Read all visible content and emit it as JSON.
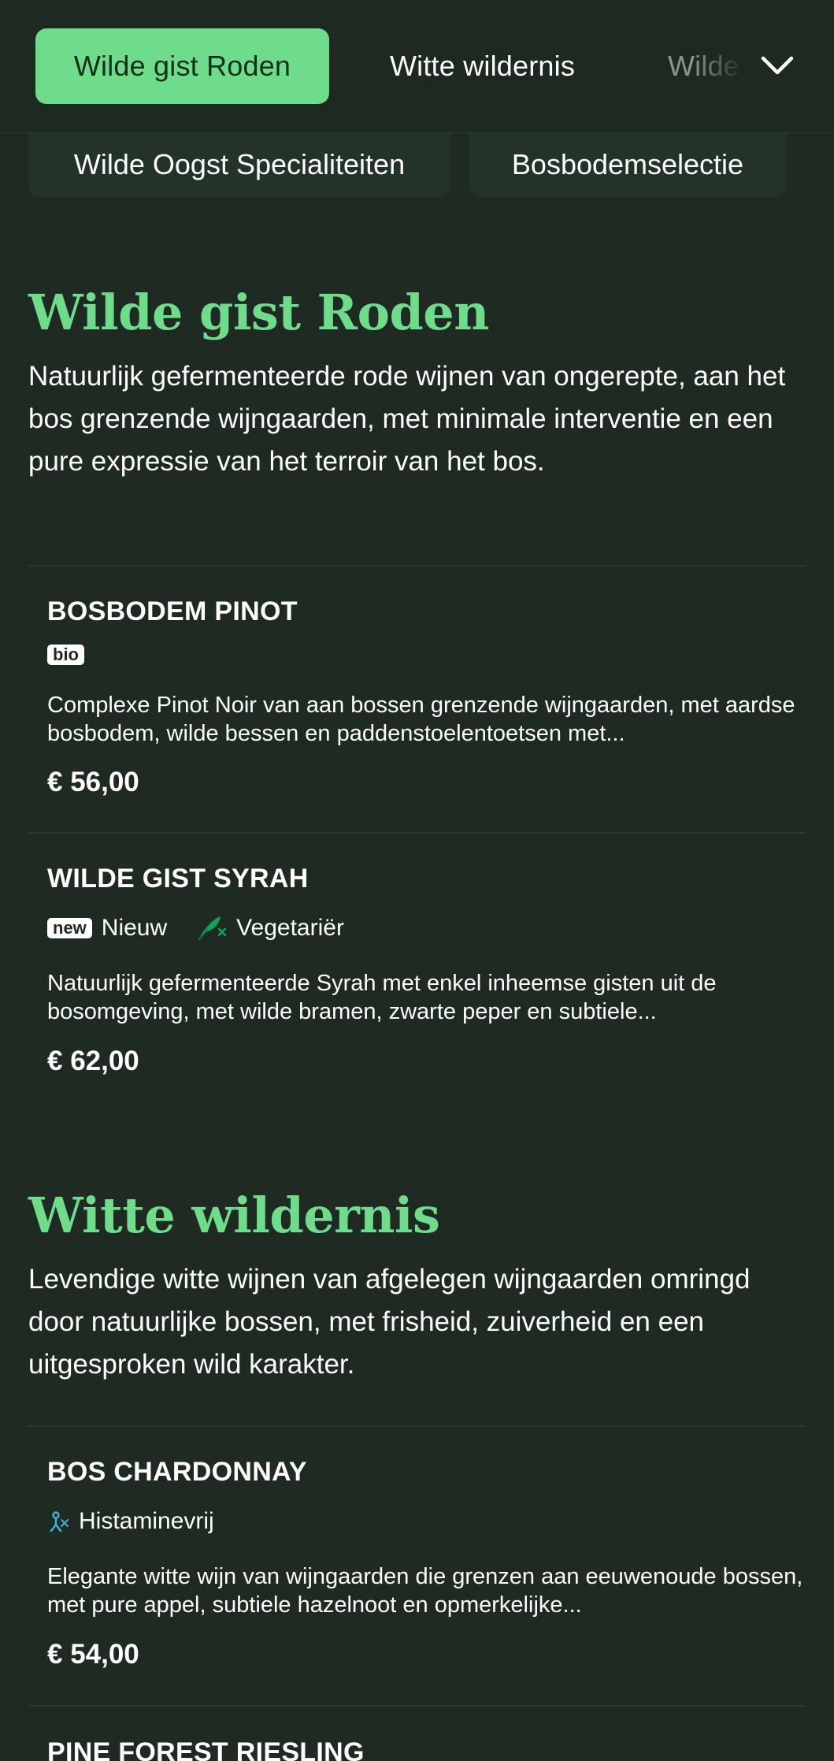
{
  "nav": {
    "tabs": [
      {
        "label": "Wilde gist Roden",
        "active": true
      },
      {
        "label": "Witte wildernis",
        "active": false
      },
      {
        "label": "Wilde",
        "active": false
      }
    ],
    "categories": [
      "Wilde Oogst Specialiteiten",
      "Bosbodemselectie"
    ],
    "dropdown_icon": "chevron-down-icon"
  },
  "sections": [
    {
      "title": "Wilde gist Roden",
      "description": "Natuurlijk gefermenteerde rode wijnen van ongerepte, aan het bos grenzende wijngaarden, met minimale interventie en een pure expressie van het terroir van het bos.",
      "items": [
        {
          "name": "BOSBODEM PINOT",
          "badges": [
            "bio"
          ],
          "tags": [],
          "description": "Complexe Pinot Noir van aan bossen grenzende wijngaarden, met aardse bosbodem, wilde bessen en paddenstoelentoetsen met...",
          "price": "€ 56,00"
        },
        {
          "name": "WILDE GIST SYRAH",
          "badges": [
            "new"
          ],
          "tags": [
            "Nieuw",
            "Vegetariër"
          ],
          "description": "Natuurlijk gefermenteerde Syrah met enkel inheemse gisten uit de bosomgeving, met wilde bramen, zwarte peper en subtiele...",
          "price": "€ 62,00"
        }
      ]
    },
    {
      "title": "Witte wildernis",
      "description": "Levendige witte wijnen van afgelegen wijngaarden omringd door natuurlijke bossen, met frisheid, zuiverheid en een uitgesproken wild karakter.",
      "items": [
        {
          "name": "BOS CHARDONNAY",
          "badges": [],
          "tags": [
            "Histaminevrij"
          ],
          "description": "Elegante witte wijn van wijngaarden die grenzen aan eeuwenoude bossen, met pure appel, subtiele hazelnoot en opmerkelijke...",
          "price": "€ 54,00"
        },
        {
          "name": "PINE FOREST RIESLING",
          "badges": [],
          "tags": [],
          "description": "",
          "price": ""
        }
      ]
    }
  ],
  "colors": {
    "background": "#1f2a22",
    "accent": "#6fdc8c",
    "vegetarian_icon": "#12a35a",
    "histamine_icon": "#3db3d6"
  }
}
